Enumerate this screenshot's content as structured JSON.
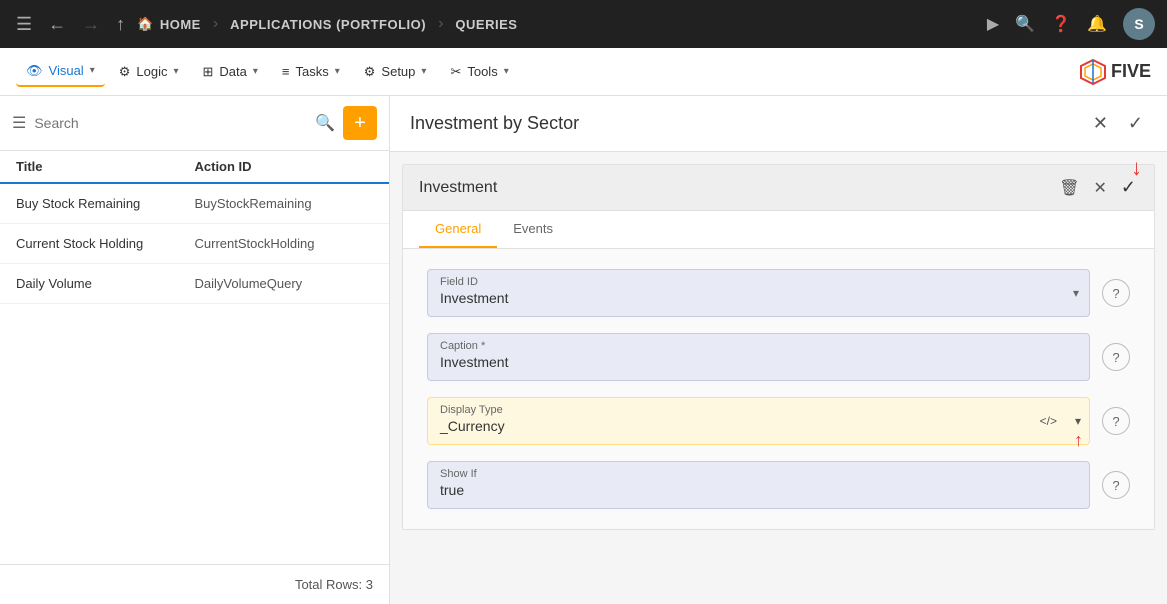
{
  "topNav": {
    "breadcrumbs": [
      "HOME",
      "APPLICATIONS (PORTFOLIO)",
      "QUERIES"
    ],
    "avatar": "S"
  },
  "menuBar": {
    "items": [
      {
        "id": "visual",
        "label": "Visual",
        "icon": "👁",
        "active": true
      },
      {
        "id": "logic",
        "label": "Logic",
        "icon": "⚙",
        "active": false
      },
      {
        "id": "data",
        "label": "Data",
        "icon": "⊞",
        "active": false
      },
      {
        "id": "tasks",
        "label": "Tasks",
        "icon": "≡",
        "active": false
      },
      {
        "id": "setup",
        "label": "Setup",
        "icon": "⚙",
        "active": false
      },
      {
        "id": "tools",
        "label": "Tools",
        "icon": "✂",
        "active": false
      }
    ],
    "logo": "FIVE"
  },
  "sidebar": {
    "searchPlaceholder": "Search",
    "columns": [
      "Title",
      "Action ID"
    ],
    "rows": [
      {
        "title": "Buy Stock Remaining",
        "actionId": "BuyStockRemaining"
      },
      {
        "title": "Current Stock Holding",
        "actionId": "CurrentStockHolding"
      },
      {
        "title": "Daily Volume",
        "actionId": "DailyVolumeQuery"
      }
    ],
    "footer": "Total Rows: 3"
  },
  "panel": {
    "title": "Investment by Sector",
    "subPanel": {
      "title": "Investment",
      "tabs": [
        "General",
        "Events"
      ],
      "activeTab": "General",
      "fields": {
        "fieldId": {
          "label": "Field ID",
          "value": "Investment"
        },
        "caption": {
          "label": "Caption *",
          "value": "Investment"
        },
        "displayType": {
          "label": "Display Type",
          "value": "_Currency"
        },
        "showIf": {
          "label": "Show If",
          "value": "true"
        }
      }
    }
  }
}
